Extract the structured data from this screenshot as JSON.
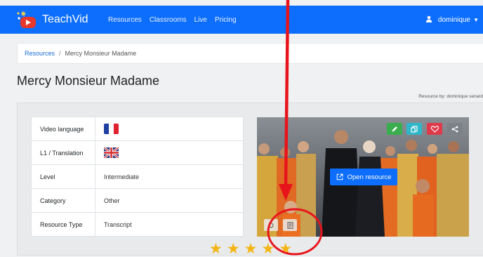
{
  "brand": {
    "name": "TeachVid"
  },
  "nav": {
    "links": [
      "Resources",
      "Classrooms",
      "Live",
      "Pricing"
    ]
  },
  "user": {
    "name": "dominique"
  },
  "breadcrumb": {
    "root": "Resources",
    "separator": "/",
    "current": "Mercy Monsieur Madame"
  },
  "page": {
    "title": "Mercy Monsieur Madame",
    "resource_by": "Resource by: dominique senard"
  },
  "info": {
    "rows": [
      {
        "label": "Video language",
        "icon": "france-flag-icon"
      },
      {
        "label": "L1 / Translation",
        "icon": "uk-flag-icon"
      },
      {
        "label": "Level",
        "value": "Intermediate"
      },
      {
        "label": "Category",
        "value": "Other"
      },
      {
        "label": "Resource Type",
        "value": "Transcript"
      }
    ]
  },
  "preview": {
    "open_label": "Open resource",
    "actions": [
      "edit-icon",
      "copy-icon",
      "heart-icon",
      "share-icon"
    ],
    "action_colors": [
      "#3aae4e",
      "#2fb6c8",
      "#e0394a",
      "#7d8288"
    ]
  },
  "rating": {
    "stars": 5,
    "value": 5
  },
  "annotation": {
    "color": "#e8141b"
  }
}
